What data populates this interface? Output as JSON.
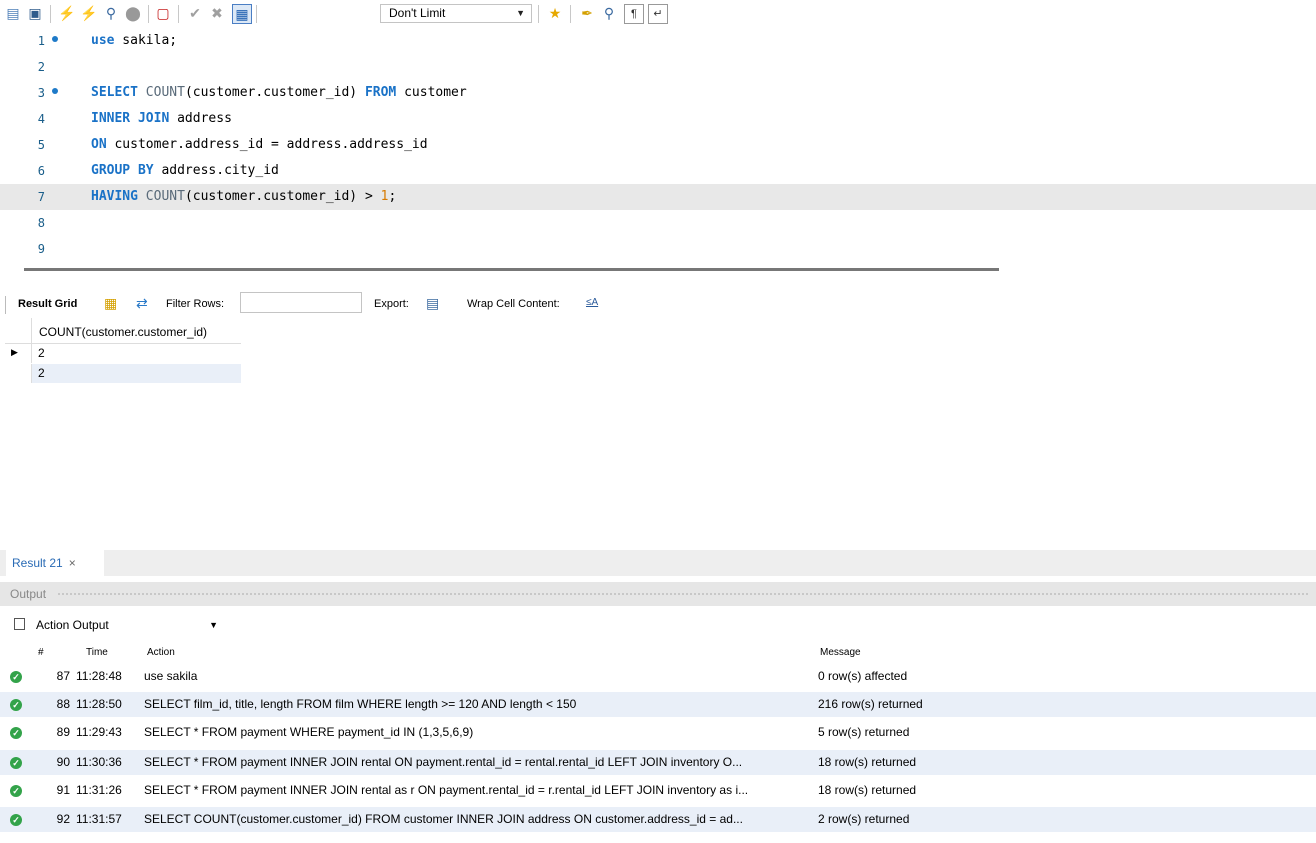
{
  "toolbar": {
    "limit_value": "Don't Limit",
    "icons": [
      "open-folder-icon",
      "save-icon",
      "execute-icon",
      "execute-current-icon",
      "explain-icon",
      "stop-icon",
      "toggle-continue-icon",
      "commit-icon",
      "rollback-icon",
      "autocommit-icon",
      "bookmark-icon",
      "beautify-icon",
      "find-icon",
      "invisible-chars-icon",
      "wrap-icon"
    ]
  },
  "editor": {
    "lines": [
      {
        "n": "1",
        "code": "use sakila;"
      },
      {
        "n": "2",
        "code": ""
      },
      {
        "n": "3",
        "code": "SELECT COUNT(customer.customer_id) FROM customer"
      },
      {
        "n": "4",
        "code": "INNER JOIN address"
      },
      {
        "n": "5",
        "code": "ON customer.address_id = address.address_id"
      },
      {
        "n": "6",
        "code": "GROUP BY address.city_id"
      },
      {
        "n": "7",
        "code": "HAVING COUNT(customer.customer_id) > 1;"
      },
      {
        "n": "8",
        "code": ""
      },
      {
        "n": "9",
        "code": ""
      }
    ]
  },
  "result_toolbar": {
    "result_grid": "Result Grid",
    "filter_rows": "Filter Rows:",
    "export": "Export:",
    "wrap_cell": "Wrap Cell Content:"
  },
  "grid": {
    "column": "COUNT(customer.customer_id)",
    "rows": [
      "2",
      "2"
    ]
  },
  "result_tab": {
    "label": "Result 21",
    "close": "×"
  },
  "output": {
    "title": "Output",
    "selector": "Action Output",
    "headers": {
      "num": "#",
      "time": "Time",
      "action": "Action",
      "message": "Message"
    },
    "rows": [
      {
        "num": "87",
        "time": "11:28:48",
        "action": "use sakila",
        "message": "0 row(s) affected"
      },
      {
        "num": "88",
        "time": "11:28:50",
        "action": "SELECT film_id, title, length FROM film WHERE length >= 120 AND length < 150",
        "message": "216 row(s) returned"
      },
      {
        "num": "89",
        "time": "11:29:43",
        "action": "SELECT * FROM payment WHERE payment_id IN (1,3,5,6,9)",
        "message": "5 row(s) returned"
      },
      {
        "num": "90",
        "time": "11:30:36",
        "action": "SELECT * FROM payment INNER JOIN rental ON payment.rental_id = rental.rental_id LEFT JOIN inventory O...",
        "message": "18 row(s) returned"
      },
      {
        "num": "91",
        "time": "11:31:26",
        "action": "SELECT * FROM payment INNER JOIN rental as r ON payment.rental_id = r.rental_id LEFT JOIN inventory as i...",
        "message": "18 row(s) returned"
      },
      {
        "num": "92",
        "time": "11:31:57",
        "action": "SELECT COUNT(customer.customer_id) FROM customer INNER JOIN address ON customer.address_id = ad...",
        "message": "2 row(s) returned"
      }
    ]
  }
}
